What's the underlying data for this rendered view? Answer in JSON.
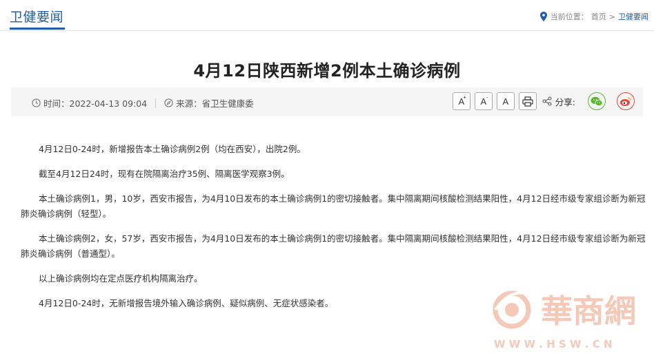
{
  "header": {
    "section_title": "卫健要闻",
    "breadcrumb_label": "当前位置：",
    "breadcrumb_home": "首页",
    "breadcrumb_sep": ">",
    "breadcrumb_current": "卫健要闻"
  },
  "article": {
    "title": "4月12日陕西新增2例本土确诊病例",
    "time_label": "时间：2022-04-13 09:04",
    "source_label": "来源：省卫生健康委",
    "share_label": "分享:",
    "font_buttons": [
      "A",
      "A",
      "A"
    ],
    "paragraphs": [
      "4月12日0-24时，新增报告本土确诊病例2例（均在西安），出院2例。",
      "截至4月12日24时，现有在院隔离治疗35例、隔离医学观察3例。",
      "本土确诊病例1，男，10岁，西安市报告，为4月10日发布的本土确诊病例1的密切接触者。集中隔离期间核酸检测结果阳性，4月12日经市级专家组诊断为新冠肺炎确诊病例（轻型）。",
      "本土确诊病例2，女，57岁，西安市报告，为4月10日发布的本土确诊病例1的密切接触者。集中隔离期间核酸检测结果阳性，4月12日经市级专家组诊断为新冠肺炎确诊病例（普通型）。",
      "以上确诊病例均在定点医疗机构隔离治疗。",
      "4月12日0-24时，无新增报告境外输入确诊病例、疑似病例、无症状感染者。"
    ]
  },
  "watermark": {
    "brand": "華商網",
    "url": "W W W . H S W . C N"
  },
  "colors": {
    "accent": "#1f5fa8",
    "wechat": "#5cb531",
    "weibo": "#e6473b",
    "watermark": "#f2b8a0"
  }
}
